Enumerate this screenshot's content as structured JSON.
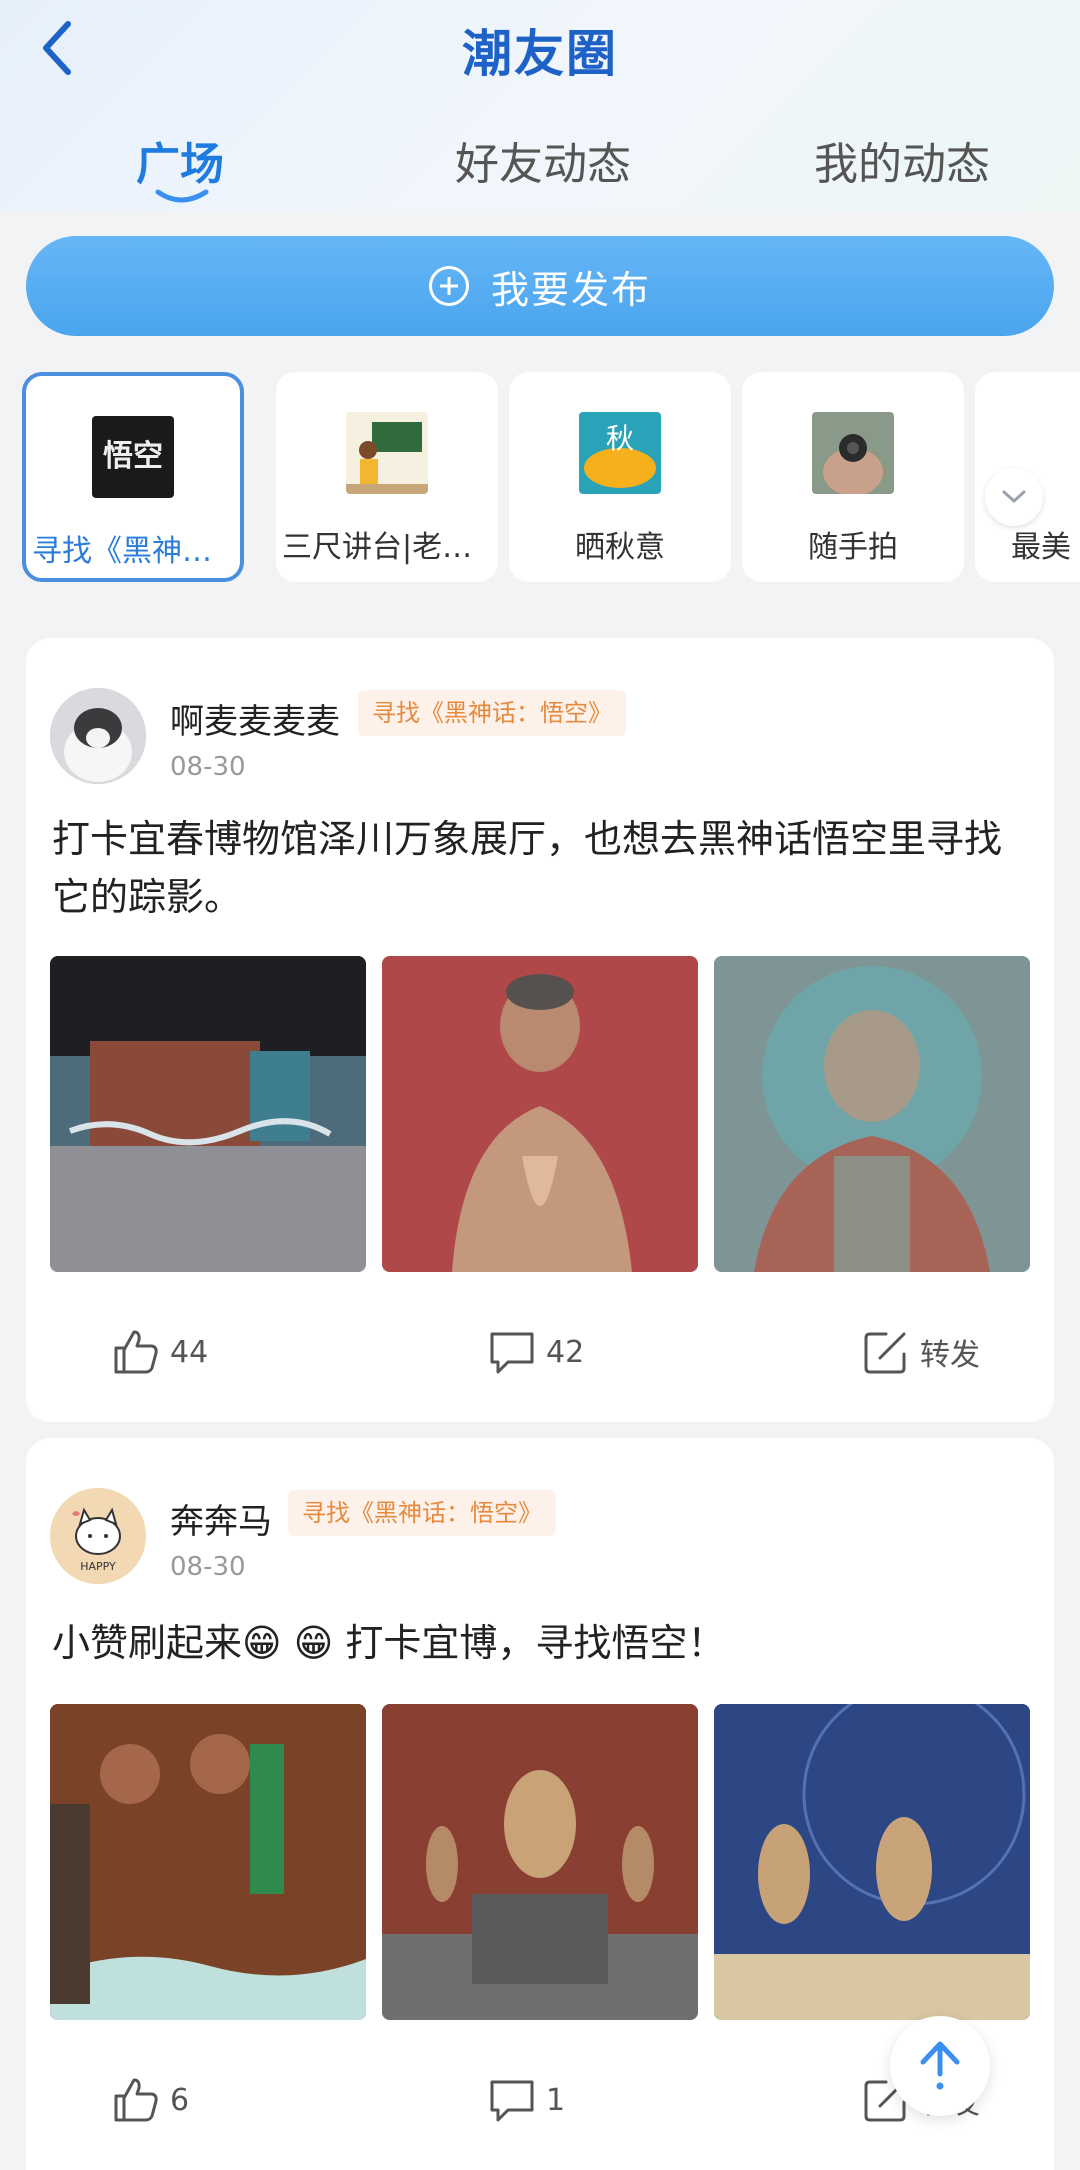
{
  "header": {
    "title": "潮友圈",
    "tabs": [
      {
        "label": "广场",
        "active": true
      },
      {
        "label": "好友动态",
        "active": false
      },
      {
        "label": "我的动态",
        "active": false
      }
    ]
  },
  "publish": {
    "label": "我要发布",
    "icon": "plus-circle-icon"
  },
  "topics": [
    {
      "label": "寻找《黑神话…",
      "active": true
    },
    {
      "label": "三尺讲台|老照…",
      "active": false
    },
    {
      "label": "晒秋意",
      "active": false
    },
    {
      "label": "随手拍",
      "active": false
    },
    {
      "label": "最美",
      "active": false
    }
  ],
  "posts": [
    {
      "username": "啊麦麦麦麦",
      "tag": "寻找《黑神话：悟空》",
      "date": "08-30",
      "text": "打卡宜春博物馆泽川万象展厅，也想去黑神话悟空里寻找它的踪影。",
      "likes": "44",
      "comments": "42",
      "share": "转发"
    },
    {
      "username": "奔奔马",
      "tag": "寻找《黑神话：悟空》",
      "date": "08-30",
      "text": "小赞刷起来😁 😁 打卡宜博，寻找悟空！",
      "likes": "6",
      "comments": "1",
      "share": "转发"
    }
  ],
  "colors": {
    "accent": "#1e7be0",
    "publish": "#4aa5ef",
    "tag_bg": "#fdf1ea",
    "tag_text": "#e68a3e"
  }
}
